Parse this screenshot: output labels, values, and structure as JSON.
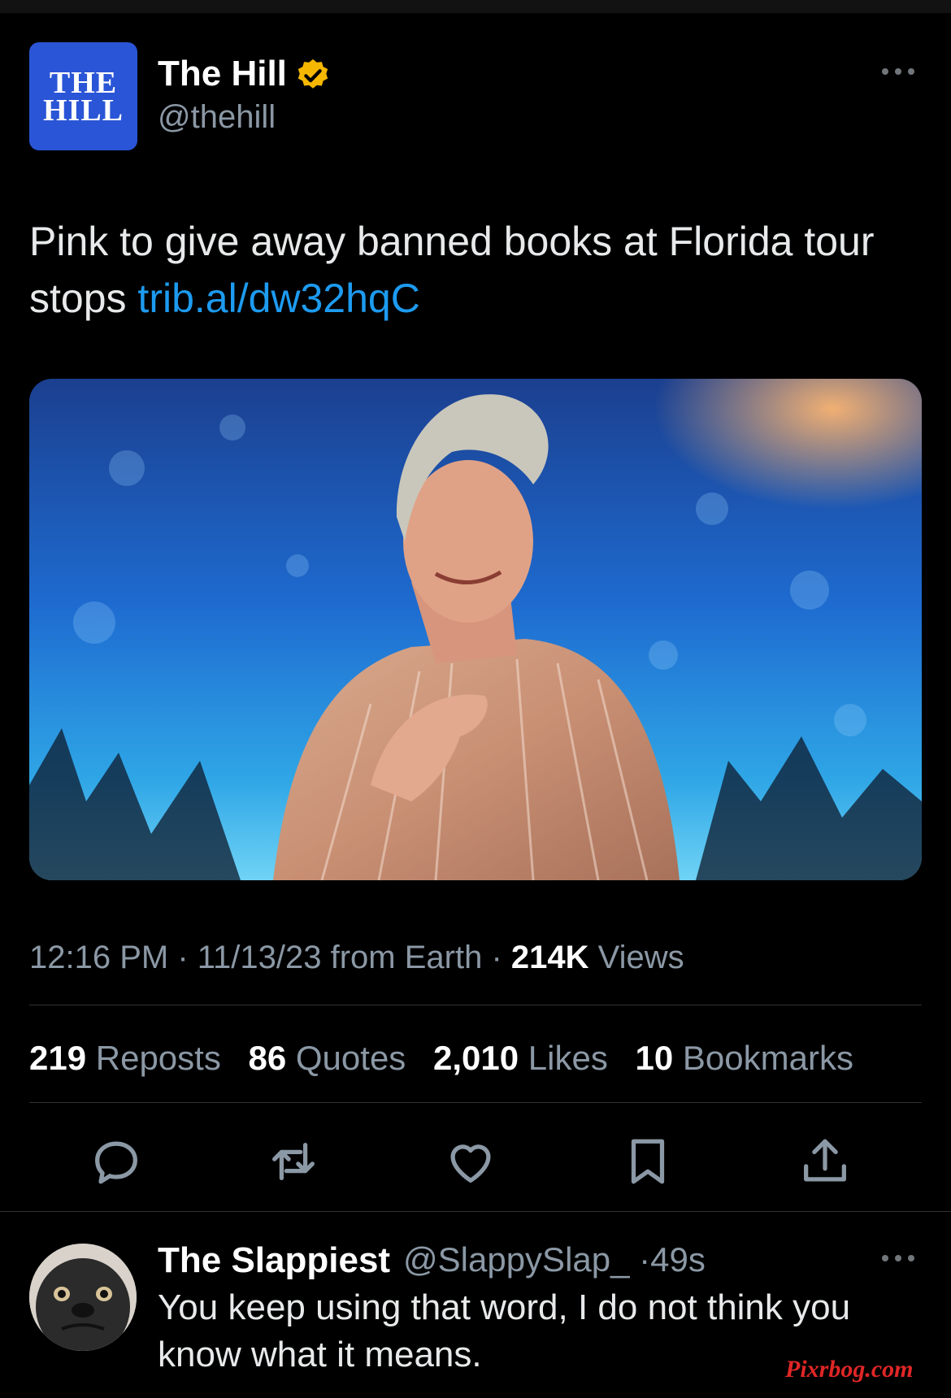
{
  "tweet": {
    "author_name": "The Hill",
    "author_logo_line1": "THE",
    "author_logo_line2": "HILL",
    "handle": "@thehill",
    "text": "Pink to give away banned books at Florida tour stops",
    "link": "trib.al/dw32hqC",
    "time": "12:16 PM",
    "date": "11/13/23",
    "source": "from Earth",
    "views_count": "214K",
    "views_label": "Views",
    "stats": [
      {
        "count": "219",
        "label": "Reposts"
      },
      {
        "count": "86",
        "label": "Quotes"
      },
      {
        "count": "2,010",
        "label": "Likes"
      },
      {
        "count": "10",
        "label": "Bookmarks"
      }
    ]
  },
  "actions": [
    "reply-icon",
    "repost-icon",
    "like-icon",
    "bookmark-icon",
    "share-icon"
  ],
  "reply": {
    "name": "The Slappiest",
    "handle": "@SlappySlap_",
    "time": "49s",
    "text": "You keep using that word, I do not think you know what it means."
  },
  "watermark": "Pixrbog.com",
  "colors": {
    "link": "#1d9bf0",
    "verified": "#f5b700",
    "logo_bg": "#2a55d6"
  }
}
